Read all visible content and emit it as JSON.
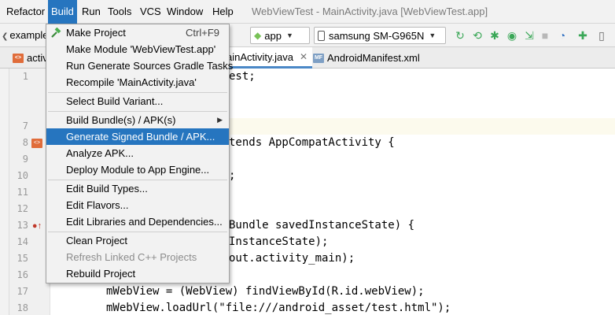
{
  "menubar": {
    "items": [
      "Refactor",
      "Build",
      "Run",
      "Tools",
      "VCS",
      "Window",
      "Help"
    ],
    "active": "Build"
  },
  "window_title": "WebViewTest - MainActivity.java [WebViewTest.app]",
  "toolbar": {
    "breadcrumb": "example",
    "config_combo": "app",
    "device_combo": "samsung SM-G965N"
  },
  "tabs": [
    {
      "label": "activ",
      "icon": "xml-layout-icon"
    },
    {
      "label": "ainActivity.java",
      "icon": "java-class-icon",
      "active": true
    },
    {
      "label": "AndroidManifest.xml",
      "icon": "manifest-icon"
    }
  ],
  "gutter": {
    "line_numbers": [
      "1",
      "",
      "",
      "",
      "",
      "",
      "",
      "7",
      "8",
      "9",
      "10",
      "11",
      "12",
      "13",
      "14",
      "15",
      "16",
      "17",
      "18"
    ]
  },
  "editor": {
    "lines": [
      {
        "n": 1,
        "text": "est;"
      },
      {
        "n": 7,
        "text": ""
      },
      {
        "n": 8,
        "text": "tends AppCompatActivity {"
      },
      {
        "n": 9,
        "text": ";"
      },
      {
        "n": 13,
        "text": "Bundle savedInstanceState) {"
      },
      {
        "n": 14,
        "text": "InstanceState);"
      },
      {
        "n": 15,
        "text": "out.activity_main);"
      },
      {
        "n": 17,
        "text": "mWebView = (WebView) findViewById(R.id.webView);"
      },
      {
        "n": 18,
        "text": "mWebView.loadUrl(\"file:///android_asset/test.html\");"
      }
    ]
  },
  "build_menu": {
    "items": [
      {
        "label": "Make Project",
        "shortcut": "Ctrl+F9",
        "icon": "hammer-icon"
      },
      {
        "label": "Make Module 'WebViewTest.app'"
      },
      {
        "label": "Run Generate Sources Gradle Tasks"
      },
      {
        "label": "Recompile 'MainActivity.java'"
      },
      {
        "label": "Select Build Variant..."
      },
      {
        "label": "Build Bundle(s) / APK(s)",
        "submenu": true
      },
      {
        "label": "Generate Signed Bundle / APK...",
        "selected": true
      },
      {
        "label": "Analyze APK..."
      },
      {
        "label": "Deploy Module to App Engine..."
      },
      {
        "label": "Edit Build Types..."
      },
      {
        "label": "Edit Flavors..."
      },
      {
        "label": "Edit Libraries and Dependencies..."
      },
      {
        "label": "Clean Project"
      },
      {
        "label": "Refresh Linked C++ Projects",
        "disabled": true
      },
      {
        "label": "Rebuild Project"
      }
    ]
  },
  "colors": {
    "menu_highlight": "#2675bf",
    "keyword": "#000080",
    "field": "#660e7a",
    "string": "#008000"
  }
}
